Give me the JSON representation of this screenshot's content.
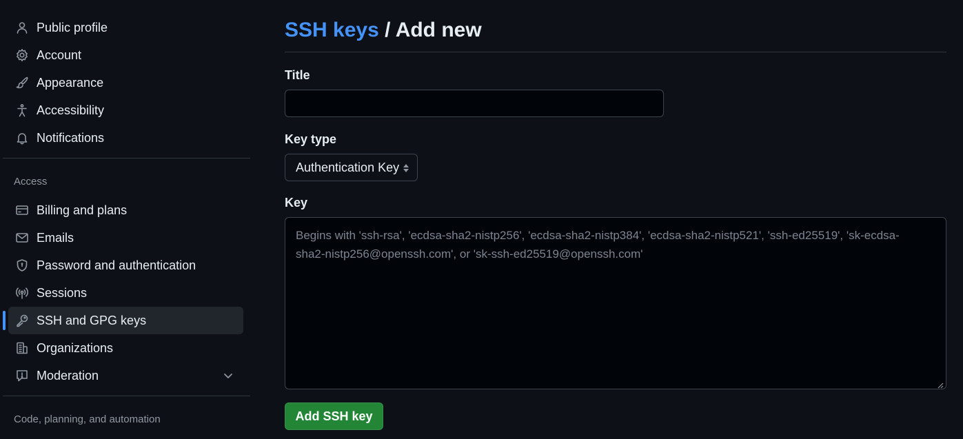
{
  "sidebar": {
    "top_items": [
      {
        "label": "Public profile",
        "icon": "person-icon"
      },
      {
        "label": "Account",
        "icon": "gear-icon"
      },
      {
        "label": "Appearance",
        "icon": "paintbrush-icon"
      },
      {
        "label": "Accessibility",
        "icon": "accessibility-icon"
      },
      {
        "label": "Notifications",
        "icon": "bell-icon"
      }
    ],
    "access_heading": "Access",
    "access_items": [
      {
        "label": "Billing and plans",
        "icon": "credit-card-icon"
      },
      {
        "label": "Emails",
        "icon": "mail-icon"
      },
      {
        "label": "Password and authentication",
        "icon": "shield-lock-icon"
      },
      {
        "label": "Sessions",
        "icon": "broadcast-icon"
      },
      {
        "label": "SSH and GPG keys",
        "icon": "key-icon",
        "active": true
      },
      {
        "label": "Organizations",
        "icon": "organization-icon"
      },
      {
        "label": "Moderation",
        "icon": "report-icon",
        "expandable": true
      }
    ],
    "code_heading": "Code, planning, and automation"
  },
  "main": {
    "breadcrumb_link": "SSH keys",
    "breadcrumb_sep": "/",
    "breadcrumb_current": "Add new",
    "title_label": "Title",
    "title_value": "",
    "key_type_label": "Key type",
    "key_type_selected": "Authentication Key",
    "key_label": "Key",
    "key_placeholder": "Begins with 'ssh-rsa', 'ecdsa-sha2-nistp256', 'ecdsa-sha2-nistp384', 'ecdsa-sha2-nistp521', 'ssh-ed25519', 'sk-ecdsa-sha2-nistp256@openssh.com', or 'sk-ssh-ed25519@openssh.com'",
    "submit_label": "Add SSH key"
  },
  "colors": {
    "background": "#0d1117",
    "link": "#4493f8",
    "active_indicator": "#4493f8",
    "primary_button": "#238636"
  }
}
